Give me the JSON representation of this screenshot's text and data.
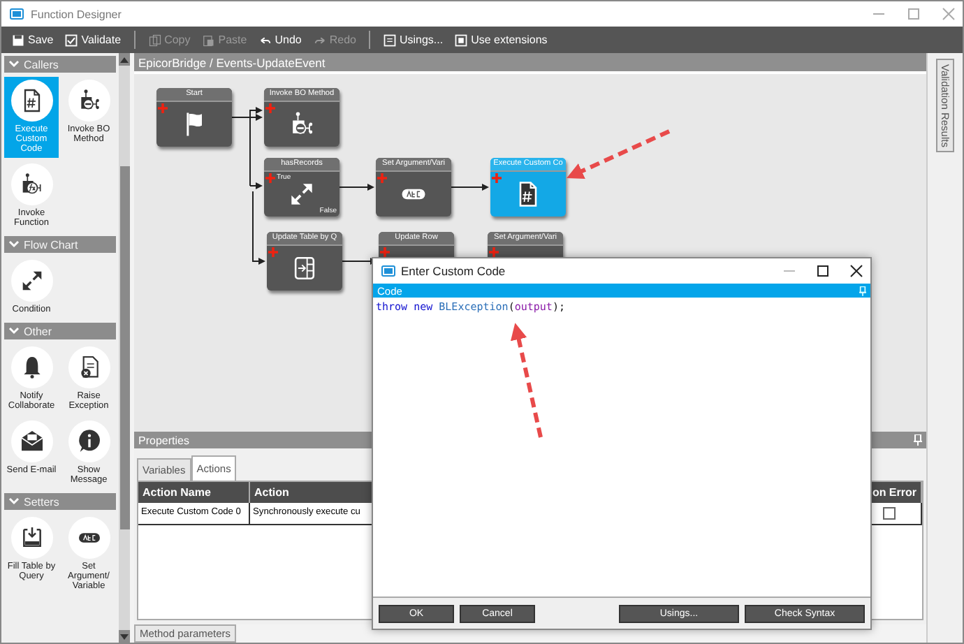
{
  "window": {
    "title": "Function Designer"
  },
  "toolbar_groups": [
    {
      "items": [
        {
          "label": "Save",
          "kind": "save",
          "disabled": false
        },
        {
          "label": "Validate",
          "kind": "validate",
          "disabled": false
        }
      ]
    },
    {
      "items": [
        {
          "label": "Copy",
          "kind": "copy",
          "disabled": true
        },
        {
          "label": "Paste",
          "kind": "paste",
          "disabled": true
        },
        {
          "label": "Undo",
          "kind": "undo",
          "disabled": false
        },
        {
          "label": "Redo",
          "kind": "redo",
          "disabled": true
        }
      ]
    },
    {
      "items": [
        {
          "label": "Usings...",
          "kind": "usings",
          "disabled": false
        },
        {
          "label": "Use extensions",
          "kind": "extensions",
          "disabled": false
        }
      ]
    }
  ],
  "toolbox": {
    "sections": [
      {
        "title": "Callers",
        "items": [
          {
            "label": "Execute Custom Code",
            "kind": "code",
            "selected": true
          },
          {
            "label": "Invoke BO Method",
            "kind": "bo",
            "selected": false
          },
          {
            "label": "Invoke Function",
            "kind": "function",
            "selected": false
          }
        ]
      },
      {
        "title": "Flow Chart",
        "items": [
          {
            "label": "Condition",
            "kind": "condition",
            "selected": false
          }
        ]
      },
      {
        "title": "Other",
        "items": [
          {
            "label": "Notify Collaborate",
            "kind": "bell",
            "selected": false
          },
          {
            "label": "Raise Exception",
            "kind": "exception",
            "selected": false
          },
          {
            "label": "Send E-mail",
            "kind": "mail",
            "selected": false
          },
          {
            "label": "Show Message",
            "kind": "info",
            "selected": false
          }
        ]
      },
      {
        "title": "Setters",
        "items": [
          {
            "label": "Fill Table by Query",
            "kind": "filltable",
            "selected": false
          },
          {
            "label": "Set Argument/ Variable",
            "kind": "abc",
            "selected": false
          }
        ]
      }
    ]
  },
  "canvas": {
    "breadcrumb": "EpicorBridge / Events-UpdateEvent",
    "nodes": [
      {
        "title": "Start",
        "kind": "flag",
        "selected": false
      },
      {
        "title": "Invoke BO Method",
        "kind": "bo",
        "selected": false
      },
      {
        "title": "hasRecords",
        "kind": "condition",
        "selected": false,
        "true_label": "True",
        "false_label": "False"
      },
      {
        "title": "Set Argument/Vari",
        "kind": "abc",
        "selected": false
      },
      {
        "title": "Execute Custom Co",
        "kind": "code",
        "selected": true
      },
      {
        "title": "Update Table by Q",
        "kind": "table",
        "selected": false
      },
      {
        "title": "Update Row",
        "kind": "row",
        "selected": false
      },
      {
        "title": "Set Argument/Vari",
        "kind": "abc",
        "selected": false
      }
    ]
  },
  "side_tab": {
    "label": "Validation Results"
  },
  "properties": {
    "title": "Properties",
    "tabs": [
      {
        "label": "Variables",
        "selected": false
      },
      {
        "label": "Actions",
        "selected": true
      }
    ],
    "columns": [
      "Action Name",
      "Action",
      "on Error"
    ],
    "rows": [
      {
        "name": "Execute Custom Code 0",
        "action": "Synchronously execute cu",
        "on_error": false
      }
    ]
  },
  "bottom_tab": {
    "label": "Method parameters"
  },
  "dialog": {
    "title": "Enter Custom Code",
    "section": "Code",
    "code": [
      {
        "text": "throw ",
        "kind": "keyword"
      },
      {
        "text": "new ",
        "kind": "keyword"
      },
      {
        "text": "BLException",
        "kind": "type"
      },
      {
        "text": "(",
        "kind": "plain"
      },
      {
        "text": "output",
        "kind": "variable"
      },
      {
        "text": ");",
        "kind": "plain"
      }
    ],
    "buttons": [
      {
        "label": "OK",
        "kind": "left"
      },
      {
        "label": "Cancel",
        "kind": "left"
      },
      {
        "label": "Usings...",
        "kind": "right"
      },
      {
        "label": "Check Syntax",
        "kind": "right"
      }
    ]
  }
}
